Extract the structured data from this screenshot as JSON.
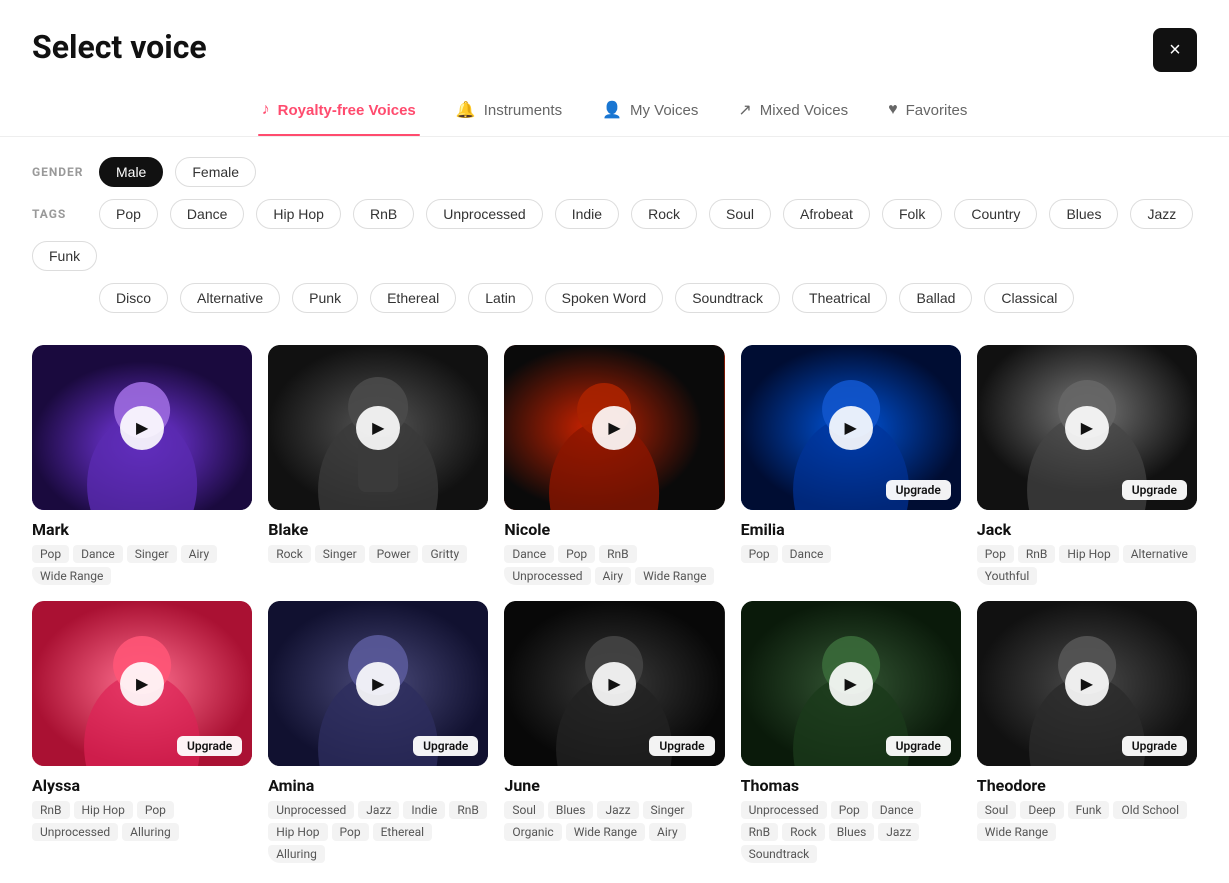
{
  "page": {
    "title": "Select voice"
  },
  "nav": {
    "tabs": [
      {
        "id": "royalty-free",
        "label": "Royalty-free Voices",
        "icon": "♪",
        "active": true
      },
      {
        "id": "instruments",
        "label": "Instruments",
        "icon": "🔔",
        "active": false
      },
      {
        "id": "my-voices",
        "label": "My Voices",
        "icon": "👤",
        "active": false
      },
      {
        "id": "mixed-voices",
        "label": "Mixed Voices",
        "icon": "↗",
        "active": false
      },
      {
        "id": "favorites",
        "label": "Favorites",
        "icon": "♥",
        "active": false
      }
    ]
  },
  "filters": {
    "gender_label": "GENDER",
    "tags_label": "TAGS",
    "gender_options": [
      "Male",
      "Female"
    ],
    "tags": [
      "Pop",
      "Dance",
      "Hip Hop",
      "RnB",
      "Unprocessed",
      "Indie",
      "Rock",
      "Soul",
      "Afrobeat",
      "Folk",
      "Country",
      "Blues",
      "Jazz",
      "Funk",
      "Disco",
      "Alternative",
      "Punk",
      "Ethereal",
      "Latin",
      "Spoken Word",
      "Soundtrack",
      "Theatrical",
      "Ballad",
      "Classical"
    ]
  },
  "voices": [
    {
      "id": "mark",
      "name": "Mark",
      "tags": [
        "Pop",
        "Dance",
        "Singer",
        "Airy",
        "Wide Range"
      ],
      "upgrade": false,
      "theme": "mark"
    },
    {
      "id": "blake",
      "name": "Blake",
      "tags": [
        "Rock",
        "Singer",
        "Power",
        "Gritty"
      ],
      "upgrade": false,
      "theme": "blake"
    },
    {
      "id": "nicole",
      "name": "Nicole",
      "tags": [
        "Dance",
        "Pop",
        "RnB",
        "Unprocessed",
        "Airy",
        "Wide Range"
      ],
      "upgrade": false,
      "theme": "nicole"
    },
    {
      "id": "emilia",
      "name": "Emilia",
      "tags": [
        "Pop",
        "Dance"
      ],
      "upgrade": true,
      "theme": "emilia"
    },
    {
      "id": "jack",
      "name": "Jack",
      "tags": [
        "Pop",
        "RnB",
        "Hip Hop",
        "Alternative",
        "Youthful"
      ],
      "upgrade": true,
      "theme": "jack"
    },
    {
      "id": "alyssa",
      "name": "Alyssa",
      "tags": [
        "RnB",
        "Hip Hop",
        "Pop",
        "Unprocessed",
        "Alluring"
      ],
      "upgrade": true,
      "theme": "alyssa"
    },
    {
      "id": "amina",
      "name": "Amina",
      "tags": [
        "Unprocessed",
        "Jazz",
        "Indie",
        "RnB",
        "Hip Hop",
        "Pop",
        "Ethereal",
        "Alluring"
      ],
      "upgrade": true,
      "theme": "amina"
    },
    {
      "id": "june",
      "name": "June",
      "tags": [
        "Soul",
        "Blues",
        "Jazz",
        "Singer",
        "Organic",
        "Wide Range",
        "Airy"
      ],
      "upgrade": true,
      "theme": "june"
    },
    {
      "id": "thomas",
      "name": "Thomas",
      "tags": [
        "Unprocessed",
        "Pop",
        "Dance",
        "RnB",
        "Rock",
        "Blues",
        "Jazz",
        "Soundtrack"
      ],
      "upgrade": true,
      "theme": "thomas"
    },
    {
      "id": "theodore",
      "name": "Theodore",
      "tags": [
        "Soul",
        "Deep",
        "Funk",
        "Old School",
        "Wide Range"
      ],
      "upgrade": true,
      "theme": "theodore"
    }
  ],
  "close_label": "×",
  "upgrade_label": "Upgrade"
}
